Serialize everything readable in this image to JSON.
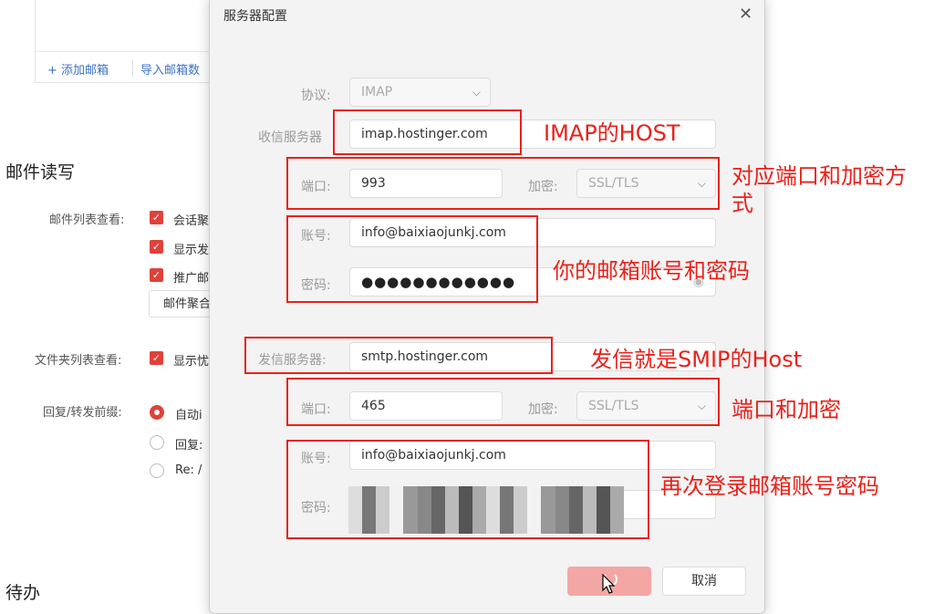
{
  "background": {
    "add_mailbox": "+ 添加邮箱",
    "import_mailbox": "导入邮箱数",
    "section_read_write": "邮件读写",
    "section_todo": "待办",
    "mail_list_label": "邮件列表查看:",
    "mail_list_options": [
      "会话聚",
      "显示发",
      "推广邮"
    ],
    "aggregate_button": "邮件聚合",
    "folder_list_label": "文件夹列表查看:",
    "folder_option": "显示忧",
    "reply_prefix_label": "回复/转发前缀:",
    "reply_options": [
      "自动i",
      "回复:",
      "Re: /"
    ]
  },
  "dialog": {
    "title": "服务器配置",
    "protocol_label": "协议:",
    "protocol_value": "IMAP",
    "incoming_label": "收信服务器",
    "incoming_host": "imap.hostinger.com",
    "in_port_label": "端口:",
    "in_port": "993",
    "in_encrypt_label": "加密:",
    "in_encrypt": "SSL/TLS",
    "in_account_label": "账号:",
    "in_account": "info@baixiaojunkj.com",
    "in_password_label": "密码:",
    "in_password": "●●●●●●●●●●●●",
    "outgoing_label": "发信服务器:",
    "outgoing_host": "smtp.hostinger.com",
    "out_port_label": "端口:",
    "out_port": "465",
    "out_encrypt_label": "加密:",
    "out_encrypt": "SSL/TLS",
    "out_account_label": "账号:",
    "out_account": "info@baixiaojunkj.com",
    "out_password_label": "密码:",
    "cancel_label": "取消"
  },
  "annotations": {
    "imap_host": "IMAP的HOST",
    "port_encrypt_1": "对应端口和加密方式",
    "account_password": "你的邮箱账号和密码",
    "smtp_host": "发信就是SMIP的Host",
    "port_encrypt_2": "端口和加密",
    "relogin": "再次登录邮箱账号密码"
  },
  "colors": {
    "accent": "#e0413a",
    "annotation": "#e8221b",
    "link": "#3b73c7"
  }
}
